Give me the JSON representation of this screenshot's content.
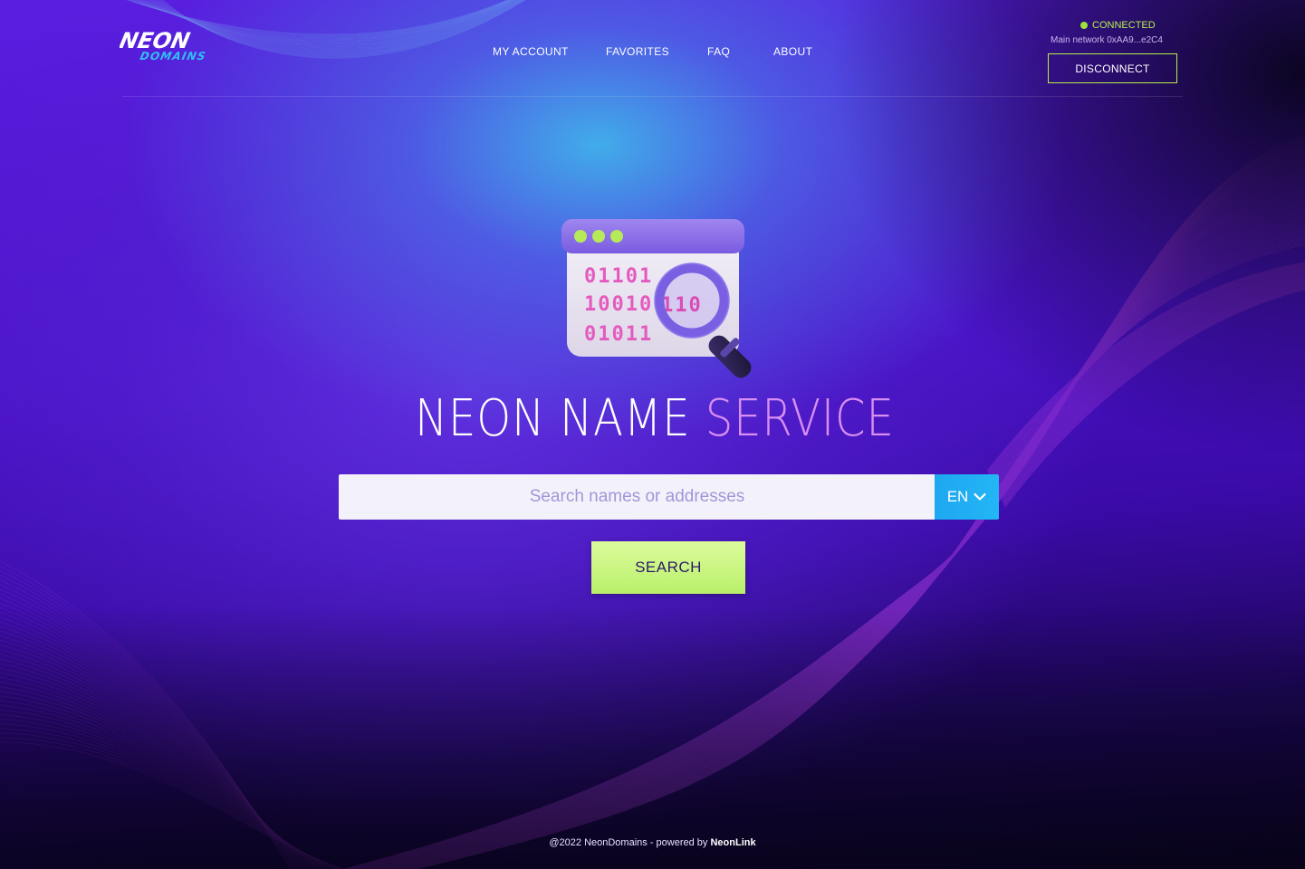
{
  "header": {
    "logo": {
      "line1": "NEON",
      "line2": "DOMAINS"
    },
    "nav": [
      {
        "label": "MY ACCOUNT"
      },
      {
        "label": "FAVORITES"
      },
      {
        "label": "FAQ"
      },
      {
        "label": "ABOUT"
      }
    ],
    "wallet": {
      "status": "CONNECTED",
      "network": "Main network 0xAA9...e2C4",
      "disconnect_label": "DISCONNECT"
    }
  },
  "hero": {
    "illustration": {
      "icon": "binary-search-window-icon",
      "binary_lines": [
        "01101",
        "10010",
        "01011"
      ],
      "overlay_digits": "110"
    },
    "title_part1": "NEON NAME ",
    "title_part2": "SERVICE"
  },
  "search": {
    "placeholder": "Search names or addresses",
    "language": "EN",
    "button_label": "SEARCH"
  },
  "footer": {
    "text": "@2022 NeonDomains - powered by ",
    "brand": "NeonLink"
  },
  "colors": {
    "accent_green": "#b6f04a",
    "title_pink": "#d98ff2",
    "lang_blue": "#1ea7f0"
  }
}
